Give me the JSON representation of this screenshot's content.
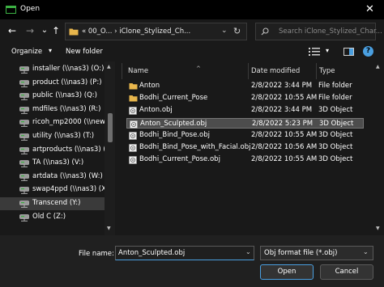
{
  "window": {
    "title": "Open",
    "close_glyph": "✕"
  },
  "nav": {
    "back_glyph": "←",
    "forward_glyph": "→",
    "recent_glyph": "⌄",
    "up_glyph": "↑",
    "breadcrumb": "«  00_O...  ›  iClone_Stylized_Ch...",
    "dropdown_glyph": "⌄",
    "refresh_glyph": "↻",
    "search_placeholder": "Search iClone_Stylized_Char..."
  },
  "toolbar": {
    "organize_label": "Organize",
    "organize_arrow": "▾",
    "new_folder_label": "New folder",
    "view_arrow": "▾",
    "help_glyph": "?"
  },
  "sidebar": {
    "items": [
      {
        "label": "installer (\\\\nas3) (O:)"
      },
      {
        "label": "product (\\\\nas3) (P:)"
      },
      {
        "label": "public (\\\\nas3) (Q:)"
      },
      {
        "label": "mdfiles (\\\\nas3) (R:)"
      },
      {
        "label": "ricoh_mp2000 (\\\\newc"
      },
      {
        "label": "utility (\\\\nas3) (T:)"
      },
      {
        "label": "artproducts (\\\\nas3) (U"
      },
      {
        "label": "TA (\\\\nas3) (V:)"
      },
      {
        "label": "artdata (\\\\nas3) (W:)"
      },
      {
        "label": "swap4ppd (\\\\nas3) (X:)"
      },
      {
        "label": "Transcend (Y:)"
      },
      {
        "label": "Old C (Z:)"
      }
    ],
    "selected_index": 10,
    "scroll_up_glyph": "▲",
    "scroll_down_glyph": "▼"
  },
  "columns": {
    "name": "Name",
    "date": "Date modified",
    "type": "Type",
    "sort_glyph": "^"
  },
  "files": [
    {
      "name": "Anton",
      "date": "2/8/2022 3:44 PM",
      "type": "File folder",
      "kind": "folder"
    },
    {
      "name": "Bodhi_Current_Pose",
      "date": "2/8/2022 10:55 AM",
      "type": "File folder",
      "kind": "folder"
    },
    {
      "name": "Anton.obj",
      "date": "2/8/2022 3:44 PM",
      "type": "3D Object",
      "kind": "object"
    },
    {
      "name": "Anton_Sculpted.obj",
      "date": "2/8/2022 5:23 PM",
      "type": "3D Object",
      "kind": "object"
    },
    {
      "name": "Bodhi_Bind_Pose.obj",
      "date": "2/8/2022 10:55 AM",
      "type": "3D Object",
      "kind": "object"
    },
    {
      "name": "Bodhi_Bind_Pose_with_Facial.obj",
      "date": "2/8/2022 10:56 AM",
      "type": "3D Object",
      "kind": "object"
    },
    {
      "name": "Bodhi_Current_Pose.obj",
      "date": "2/8/2022 10:55 AM",
      "type": "3D Object",
      "kind": "object"
    }
  ],
  "selected_file_index": 3,
  "footer": {
    "filename_label": "File name:",
    "filename_value": "Anton_Sculpted.obj",
    "filter_value": "Obj format file (*.obj)",
    "dropdown_glyph": "⌄",
    "open_label": "Open",
    "cancel_label": "Cancel"
  },
  "colors": {
    "background": "#191919",
    "titlebar": "#000000",
    "accent": "#4a9fe0",
    "selected_row": "#4d4d4d",
    "folder": "#e8b64c"
  }
}
